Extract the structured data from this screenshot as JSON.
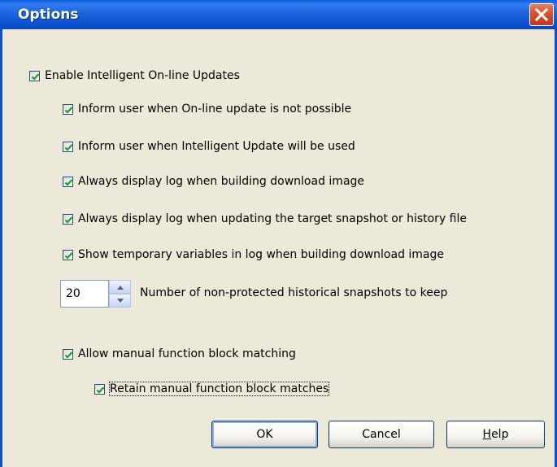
{
  "window": {
    "title": "Options"
  },
  "options": {
    "enable_updates": {
      "label": "Enable Intelligent On-line Updates",
      "checked": true
    },
    "items": [
      {
        "label": "Inform user when On-line update is not possible",
        "checked": true
      },
      {
        "label": "Inform user when Intelligent Update will be used",
        "checked": true
      },
      {
        "label": "Always display log when building download image",
        "checked": true
      },
      {
        "label": "Always display log when updating the target snapshot or history file",
        "checked": true
      },
      {
        "label": "Show temporary variables in log when building download image",
        "checked": true
      }
    ],
    "snapshots": {
      "value": "20",
      "label": "Number of non-protected historical snapshots to keep"
    },
    "manual_matching": {
      "label": "Allow manual function block matching",
      "checked": true
    },
    "retain_matches": {
      "label": "Retain manual function block matches",
      "checked": true
    }
  },
  "buttons": {
    "ok": "OK",
    "cancel": "Cancel",
    "help_underlined": "H",
    "help_rest": "elp"
  },
  "colors": {
    "title_bar": "#0a5fe0",
    "face": "#ece9d8",
    "check": "#21a121",
    "close": "#d9522d"
  },
  "icons": [
    "close-icon",
    "checkmark-icon",
    "spin-up-icon",
    "spin-down-icon"
  ]
}
